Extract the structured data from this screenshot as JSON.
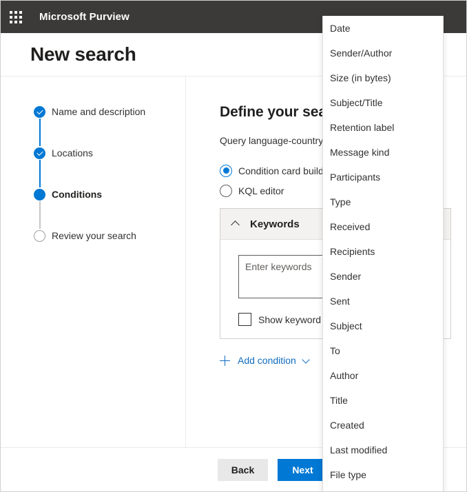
{
  "suite": {
    "waffle_icon": "app-launcher-waffle-icon",
    "title": "Microsoft Purview"
  },
  "header": {
    "page_title": "New search"
  },
  "stepper": {
    "items": [
      {
        "label": "Name and description",
        "state": "completed"
      },
      {
        "label": "Locations",
        "state": "completed"
      },
      {
        "label": "Conditions",
        "state": "current"
      },
      {
        "label": "Review your search",
        "state": "pending"
      }
    ]
  },
  "main": {
    "heading": "Define your search conditions",
    "description": "Query language-country/region",
    "query_modes": [
      {
        "label": "Condition card builder",
        "selected": true
      },
      {
        "label": "KQL editor",
        "selected": false
      }
    ],
    "condition_card": {
      "collapse_icon": "chevron-up-icon",
      "title": "Keywords",
      "keywords_value": "",
      "keywords_placeholder": "Enter keywords",
      "show_keyword_list_label": "Show keyword list",
      "show_keyword_list_checked": false
    },
    "add_condition": {
      "plus_icon": "plus-icon",
      "label": "Add condition",
      "chevron_icon": "chevron-down-icon"
    }
  },
  "dropdown": {
    "items": [
      "Date",
      "Sender/Author",
      "Size (in bytes)",
      "Subject/Title",
      "Retention label",
      "Message kind",
      "Participants",
      "Type",
      "Received",
      "Recipients",
      "Sender",
      "Sent",
      "Subject",
      "To",
      "Author",
      "Title",
      "Created",
      "Last modified",
      "File type"
    ]
  },
  "footer": {
    "back_label": "Back",
    "next_label": "Next"
  },
  "colors": {
    "suitebar_bg": "#3b3a39",
    "accent": "#0078d4",
    "link": "#0f6cbd",
    "card_header_bg": "#f3f2f1"
  }
}
